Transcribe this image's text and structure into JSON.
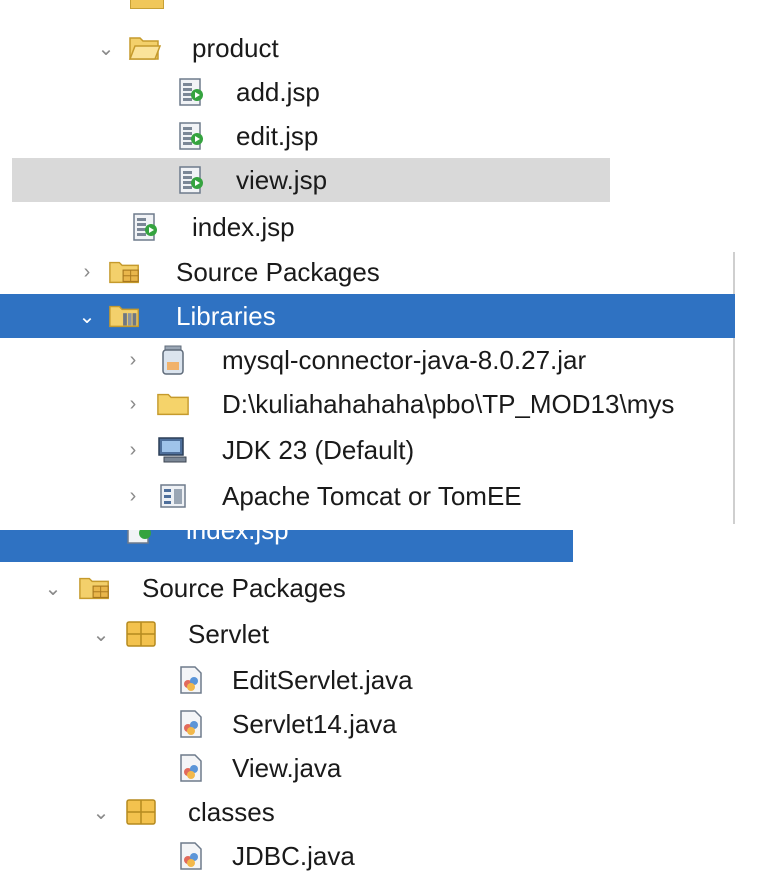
{
  "panel1": {
    "rows": [
      {
        "label": "product",
        "expanded": true,
        "icon": "folder-open-icon"
      },
      {
        "label": "add.jsp",
        "icon": "jsp-file-icon"
      },
      {
        "label": "edit.jsp",
        "icon": "jsp-file-icon"
      },
      {
        "label": "view.jsp",
        "icon": "jsp-file-icon",
        "selected": true
      },
      {
        "label": "index.jsp",
        "icon": "jsp-file-icon"
      }
    ]
  },
  "panel2": {
    "rows": [
      {
        "label": "Source Packages",
        "icon": "source-packages-icon"
      },
      {
        "label": "Libraries",
        "expanded": true,
        "icon": "libraries-folder-icon",
        "selected": true
      },
      {
        "label": "mysql-connector-java-8.0.27.jar",
        "icon": "jar-icon"
      },
      {
        "label": "D:\\kuliahahahaha\\pbo\\TP_MOD13\\mys",
        "icon": "folder-icon"
      },
      {
        "label": "JDK 23 (Default)",
        "icon": "jdk-icon"
      },
      {
        "label": "Apache Tomcat or TomEE",
        "icon": "server-icon"
      }
    ]
  },
  "panel3": {
    "rows": [
      {
        "label": "index.jsp",
        "icon": "jsp-file-icon",
        "selected": true
      },
      {
        "label": "Source Packages",
        "expanded": true,
        "icon": "source-packages-icon"
      },
      {
        "label": "Servlet",
        "expanded": true,
        "icon": "package-icon"
      },
      {
        "label": "EditServlet.java",
        "icon": "java-file-icon"
      },
      {
        "label": "Servlet14.java",
        "icon": "java-file-icon"
      },
      {
        "label": "View.java",
        "icon": "java-file-icon"
      },
      {
        "label": "classes",
        "expanded": true,
        "icon": "package-icon"
      },
      {
        "label": "JDBC.java",
        "icon": "java-file-icon"
      }
    ]
  },
  "colors": {
    "selection_blue": "#2f72c2",
    "selection_gray": "#d9d9d9",
    "folder": "#f5d36a"
  }
}
